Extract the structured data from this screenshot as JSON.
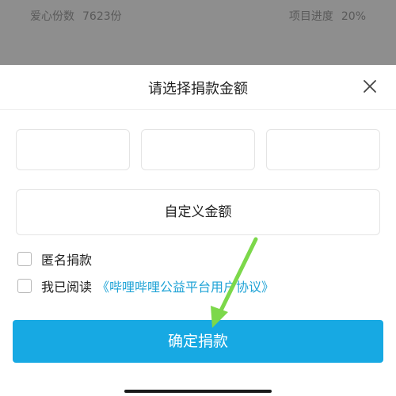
{
  "background": {
    "love_label": "爱心份数",
    "love_value": "7623份",
    "progress_label": "项目进度",
    "progress_value": "20%"
  },
  "sheet": {
    "title": "请选择捐款金额",
    "close_icon": "close-icon",
    "amount_options": [
      "",
      "",
      ""
    ],
    "custom_amount_label": "自定义金额",
    "anonymous_label": "匿名捐款",
    "agree_prefix": "我已阅读",
    "agreement_link": "《哔哩哔哩公益平台用户协议》",
    "confirm_label": "确定捐款"
  },
  "colors": {
    "accent": "#17a9e3",
    "link": "#1fa3d6",
    "backdrop": "#8e8e8e",
    "annotation_arrow": "#7cd84a"
  }
}
